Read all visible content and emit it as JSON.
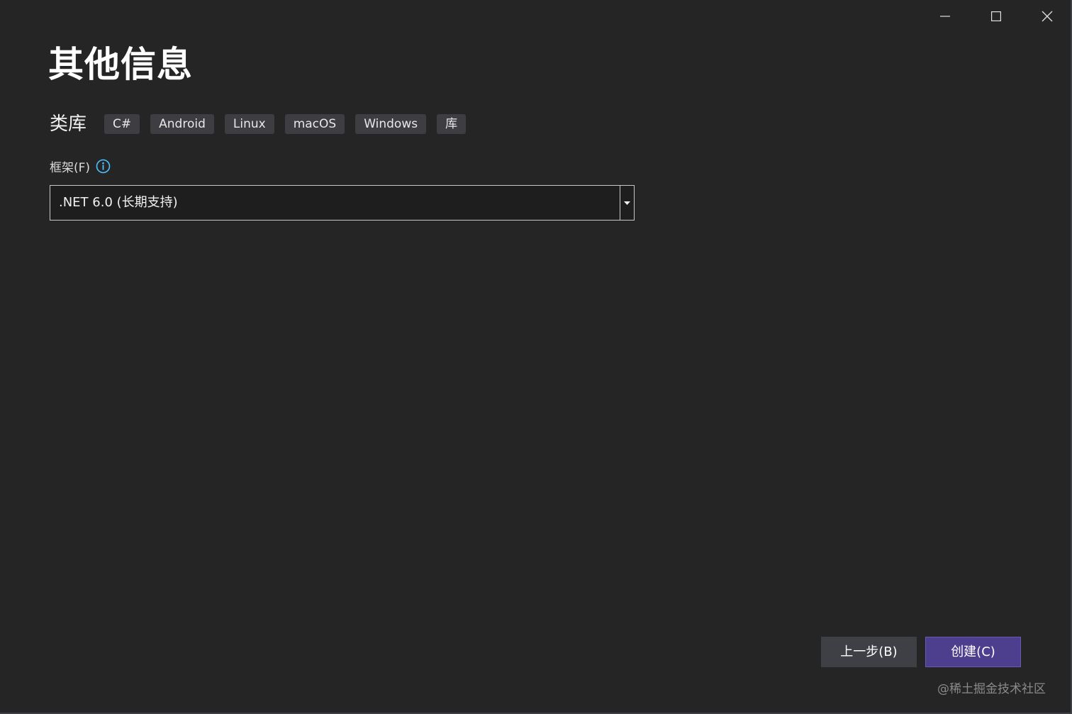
{
  "window_controls": {
    "minimize_icon": "minimize-icon",
    "maximize_icon": "maximize-icon",
    "close_icon": "close-icon"
  },
  "page": {
    "title": "其他信息"
  },
  "template": {
    "name": "类库",
    "tags": [
      "C#",
      "Android",
      "Linux",
      "macOS",
      "Windows",
      "库"
    ]
  },
  "framework": {
    "label": "框架(F)",
    "info_icon": "info-icon",
    "selected_value": ".NET 6.0 (长期支持)",
    "dropdown_icon": "caret-down-icon"
  },
  "footer": {
    "back_label": "上一步(B)",
    "create_label": "创建(C)",
    "watermark": "@稀土掘金技术社区"
  },
  "colors": {
    "background": "#252526",
    "tag_background": "#3e3e42",
    "accent_button": "#4e3e8e",
    "info_icon": "#4fc1ff"
  }
}
